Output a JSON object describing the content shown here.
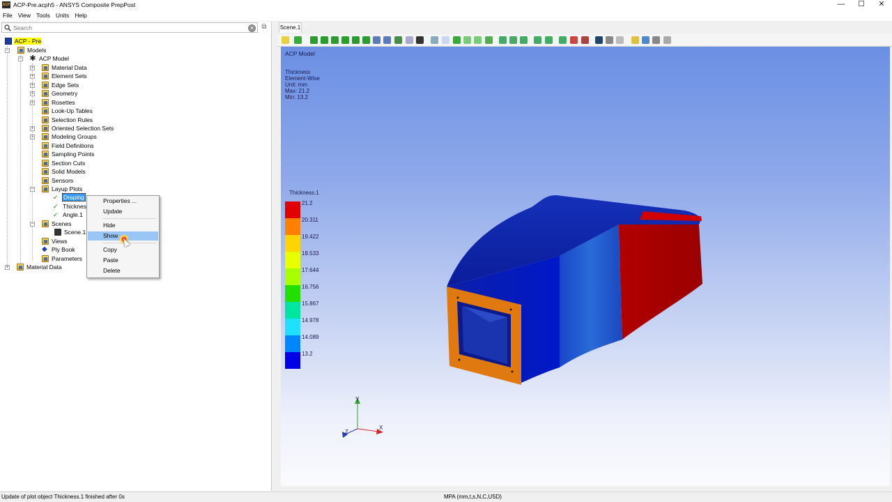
{
  "window": {
    "title": "ACP-Pre.acph5 - ANSYS Composite PrepPost",
    "app_icon_text": "ACP"
  },
  "menu": [
    "File",
    "View",
    "Tools",
    "Units",
    "Help"
  ],
  "search": {
    "placeholder": "Search",
    "value": ""
  },
  "tree": {
    "root": "ACP - Pre",
    "models": "Models",
    "acp_model": "ACP Model",
    "items": [
      "Material Data",
      "Element Sets",
      "Edge Sets",
      "Geometry",
      "Rosettes",
      "Look-Up Tables",
      "Selection Rules",
      "Oriented Selection Sets",
      "Modeling Groups",
      "Field Definitions",
      "Sampling Points",
      "Section Cuts",
      "Solid Models",
      "Sensors"
    ],
    "layup_plots": "Layup Plots",
    "layup_children": [
      "Draping",
      "Thicknes",
      "Angle.1"
    ],
    "scenes": "Scenes",
    "scene_child": "Scene.1",
    "views": "Views",
    "ply_book": "Ply Book",
    "parameters": "Parameters",
    "material_data_root": "Material Data"
  },
  "context_menu": [
    "Properties ...",
    "Update",
    "Hide",
    "Show",
    "Copy",
    "Paste",
    "Delete"
  ],
  "scene_tab": "Scene.1",
  "viewport": {
    "title": "ACP Model",
    "info": [
      "Thickness",
      "Element-Wise",
      "Unit: mm",
      "Max: 21.2",
      "Min: 13.2"
    ],
    "legend_title": "Thickness.1",
    "legend_values": [
      "21.2",
      "20.311",
      "19.422",
      "18.533",
      "17.644",
      "16.756",
      "15.867",
      "14.978",
      "14.089",
      "13.2"
    ],
    "legend_colors": [
      "#e10000",
      "#ff7f00",
      "#ffd400",
      "#e8ff00",
      "#a8ff00",
      "#22e000",
      "#00e6a0",
      "#1ee0ff",
      "#0086ff",
      "#0000e6"
    ],
    "axes": {
      "x": "X",
      "y": "Y",
      "z": "Z"
    }
  },
  "status": {
    "message": "Update of plot object Thickness.1 finished after 0s",
    "units": "MPA (mm,t,s,N,C,USD)"
  }
}
